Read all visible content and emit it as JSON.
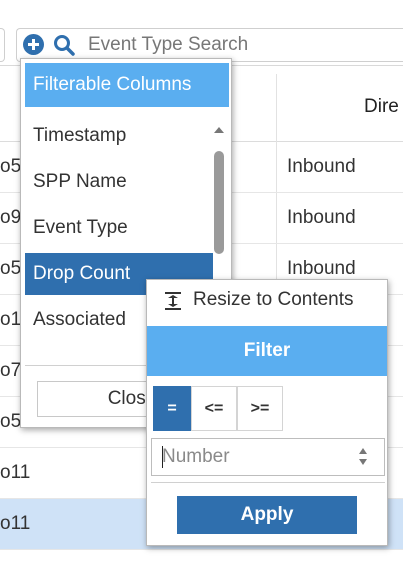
{
  "search": {
    "placeholder": "Event Type Search",
    "add_icon": "plus-circle-icon",
    "search_icon": "magnifier-icon"
  },
  "table": {
    "header_direction": "Dire",
    "rows": [
      {
        "left": "o5",
        "direction": "Inbound",
        "selected": false
      },
      {
        "left": "o9",
        "direction": "Inbound",
        "selected": false
      },
      {
        "left": "o5",
        "direction": "Inbound",
        "selected": false
      },
      {
        "left": "o1",
        "direction": "",
        "selected": false
      },
      {
        "left": "o7",
        "direction": "",
        "selected": false
      },
      {
        "left": "o5",
        "direction": "",
        "selected": false
      },
      {
        "left": "o11",
        "direction": "",
        "selected": false
      },
      {
        "left": "o11",
        "direction": "",
        "selected": true
      }
    ]
  },
  "columns_popup": {
    "title": "Filterable Columns",
    "items": [
      {
        "label": "Timestamp",
        "active": false
      },
      {
        "label": "SPP Name",
        "active": false
      },
      {
        "label": "Event Type",
        "active": false
      },
      {
        "label": "Drop Count",
        "active": true
      },
      {
        "label": "Associated",
        "active": false
      }
    ],
    "close_label": "Close"
  },
  "filter_popup": {
    "resize_label": "Resize to Contents",
    "title": "Filter",
    "operators": [
      "=",
      "<=",
      ">="
    ],
    "selected_operator": "=",
    "number_placeholder": "Number",
    "apply_label": "Apply"
  },
  "colors": {
    "header_blue": "#5aaef0",
    "active_blue": "#2f6fae",
    "selected_row": "#cfe2f7"
  }
}
